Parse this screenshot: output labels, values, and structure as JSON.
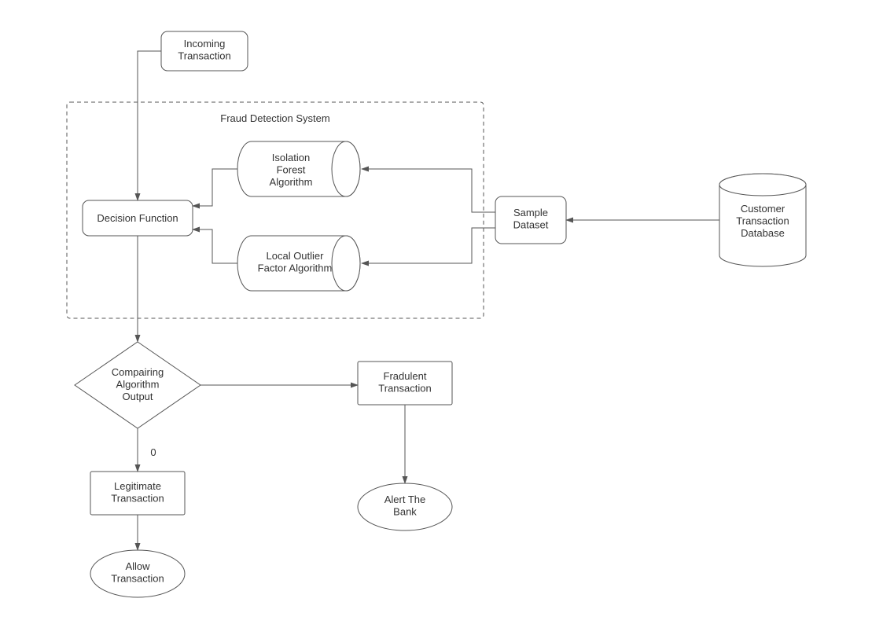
{
  "nodes": {
    "incoming": "Incoming\nTransaction",
    "systemTitle": "Fraud Detection System",
    "decision": "Decision Function",
    "isoForest": "Isolation\nForest\nAlgorithm",
    "lof": "Local Outlier\nFactor Algorithm",
    "sample": "Sample\nDataset",
    "database": "Customer\nTransaction\nDatabase",
    "compare": "Compairing\nAlgorithm\nOutput",
    "compareEdge": "0",
    "legit": "Legitimate\nTransaction",
    "fraud": "Fradulent\nTransaction",
    "allow": "Allow\nTransaction",
    "alert": "Alert The\nBank"
  }
}
